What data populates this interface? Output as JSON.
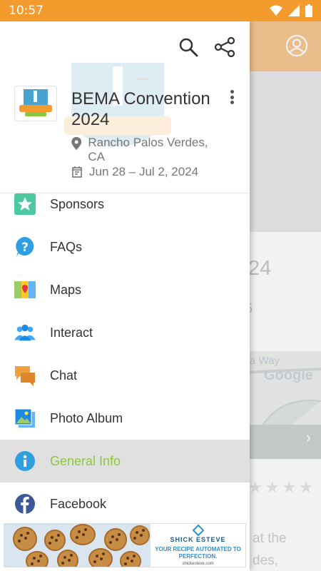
{
  "status_bar": {
    "time": "10:57"
  },
  "drawer": {
    "event_title": "BEMA Convention 2024",
    "location": "Rancho Palos Verdes, CA",
    "dates": "Jun 28 – Jul 2, 2024",
    "menu": [
      {
        "label": "Sponsors",
        "icon": "star-icon"
      },
      {
        "label": "FAQs",
        "icon": "question-icon"
      },
      {
        "label": "Maps",
        "icon": "map-icon"
      },
      {
        "label": "Interact",
        "icon": "people-icon"
      },
      {
        "label": "Chat",
        "icon": "chat-icon"
      },
      {
        "label": "Photo Album",
        "icon": "photo-icon"
      },
      {
        "label": "General Info",
        "icon": "info-icon",
        "active": true
      },
      {
        "label": "Facebook",
        "icon": "facebook-icon"
      }
    ]
  },
  "background": {
    "title_fragment": "24",
    "subtitle_fragment": "5",
    "map_road": "a Way",
    "map_logo": "Google",
    "text_line1": "at the",
    "text_line2": "des,"
  },
  "ad": {
    "brand": "SHICK ESTEVE",
    "tagline": "YOUR RECIPE AUTOMATED TO PERFECTION.",
    "url": "shickesteve.com"
  },
  "colors": {
    "accent": "#F39B2C",
    "active": "#8DC63F"
  }
}
